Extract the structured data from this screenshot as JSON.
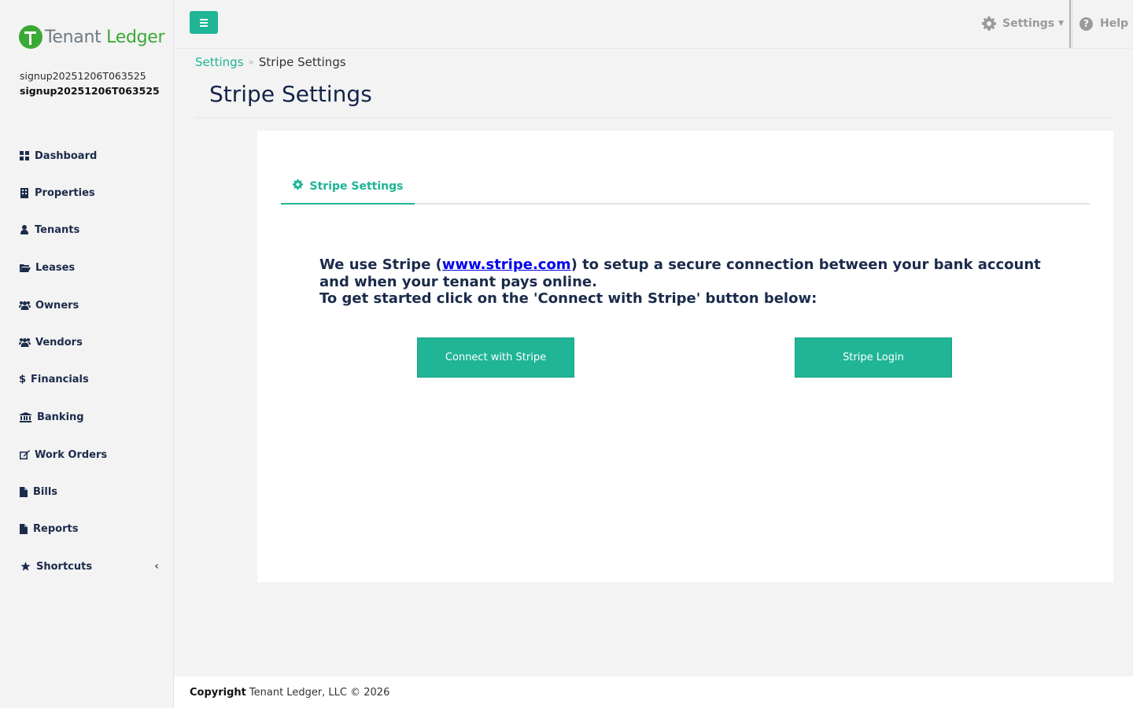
{
  "sidebar": {
    "logo": {
      "tenant": "Tenant",
      "ledger": "Ledger"
    },
    "user": {
      "line1": "signup20251206T063525",
      "line2": "signup20251206T063525"
    },
    "items": [
      {
        "label": "Dashboard",
        "icon": "dashboard-icon"
      },
      {
        "label": "Properties",
        "icon": "building-icon"
      },
      {
        "label": "Tenants",
        "icon": "user-icon"
      },
      {
        "label": "Leases",
        "icon": "folder-open-icon"
      },
      {
        "label": "Owners",
        "icon": "users-icon"
      },
      {
        "label": "Vendors",
        "icon": "users-icon"
      },
      {
        "label": "Financials",
        "icon": "dollar-icon"
      },
      {
        "label": "Banking",
        "icon": "bank-icon"
      },
      {
        "label": "Work Orders",
        "icon": "edit-icon"
      },
      {
        "label": "Bills",
        "icon": "file-icon"
      },
      {
        "label": "Reports",
        "icon": "file-icon"
      },
      {
        "label": "Shortcuts",
        "icon": "star-icon"
      }
    ]
  },
  "topbar": {
    "settings_label": "Settings",
    "help_label": "Help"
  },
  "breadcrumb": {
    "parent": "Settings",
    "current": "Stripe Settings"
  },
  "page": {
    "title": "Stripe Settings"
  },
  "tab": {
    "label": "Stripe Settings"
  },
  "content": {
    "intro_before": "We use Stripe (",
    "intro_link": "www.stripe.com",
    "intro_after": ") to setup a secure connection between your bank account and when your tenant pays online.",
    "intro_line2": "To get started click on the 'Connect with Stripe' button below:",
    "connect_button": "Connect with Stripe",
    "login_button": "Stripe Login"
  },
  "footer": {
    "bold": "Copyright",
    "text": "Tenant Ledger, LLC © 2026"
  },
  "colors": {
    "accent": "#1fb596",
    "logo_green": "#3aa935",
    "navy": "#14244a"
  }
}
